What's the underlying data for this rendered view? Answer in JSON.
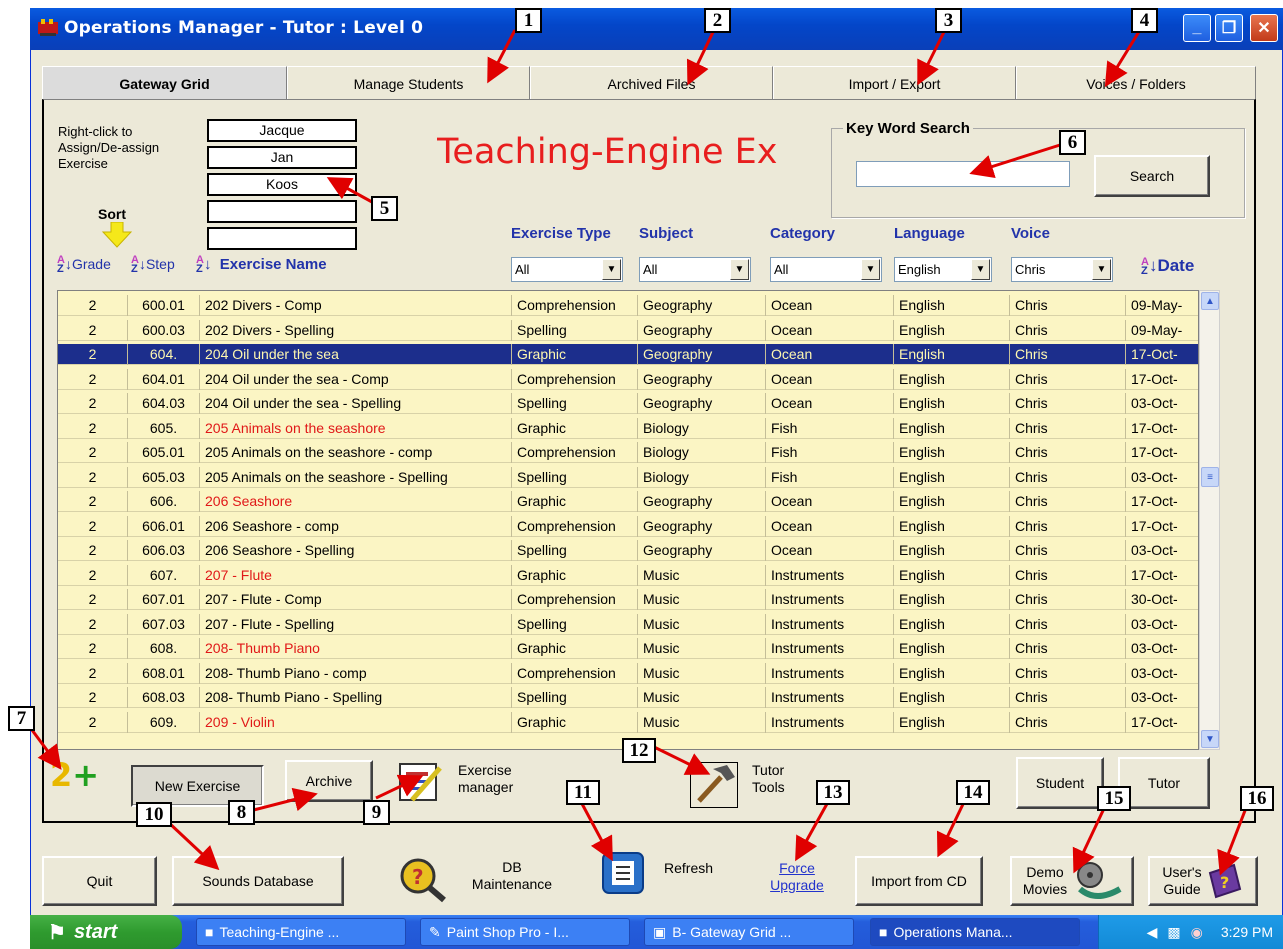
{
  "window": {
    "title": "Operations Manager - Tutor  :  Level 0",
    "controls": [
      "minimize-icon",
      "restore-icon",
      "close-icon"
    ]
  },
  "tabs": [
    {
      "label": "Gateway Grid",
      "active": true
    },
    {
      "label": "Manage Students",
      "active": false
    },
    {
      "label": "Archived Files",
      "active": false
    },
    {
      "label": "Import / Export",
      "active": false
    },
    {
      "label": "Voices / Folders",
      "active": false
    }
  ],
  "assign_hint": "Right-click to Assign/De-assign Exercise",
  "students": [
    "Jacque",
    "Jan",
    "Koos",
    "",
    ""
  ],
  "banner_title": "Teaching-Engine Ex",
  "keyword_search": {
    "label": "Key Word Search",
    "value": "",
    "button": "Search"
  },
  "sort_label": "Sort",
  "columns": {
    "grade": "Grade",
    "step": "Step",
    "exercise_name": "Exercise Name",
    "exercise_type": "Exercise Type",
    "subject": "Subject",
    "category": "Category",
    "language": "Language",
    "voice": "Voice",
    "date": "Date"
  },
  "filters": {
    "exercise_type": "All",
    "subject": "All",
    "category": "All",
    "language": "English",
    "voice": "Chris"
  },
  "rows": [
    {
      "grade": "2",
      "step": "600.01",
      "name": "202 Divers - Comp",
      "type": "Comprehension",
      "subject": "Geography",
      "category": "Ocean",
      "language": "English",
      "voice": "Chris",
      "date": "09-May-",
      "red": false,
      "selected": false
    },
    {
      "grade": "2",
      "step": "600.03",
      "name": "202 Divers - Spelling",
      "type": "Spelling",
      "subject": "Geography",
      "category": "Ocean",
      "language": "English",
      "voice": "Chris",
      "date": "09-May-",
      "red": false,
      "selected": false
    },
    {
      "grade": "2",
      "step": "604.",
      "name": "204 Oil under the sea",
      "type": "Graphic",
      "subject": "Geography",
      "category": "Ocean",
      "language": "English",
      "voice": "Chris",
      "date": "17-Oct-",
      "red": false,
      "selected": true
    },
    {
      "grade": "2",
      "step": "604.01",
      "name": "204 Oil under the sea - Comp",
      "type": "Comprehension",
      "subject": "Geography",
      "category": "Ocean",
      "language": "English",
      "voice": "Chris",
      "date": "17-Oct-",
      "red": false,
      "selected": false
    },
    {
      "grade": "2",
      "step": "604.03",
      "name": "204 Oil under the sea - Spelling",
      "type": "Spelling",
      "subject": "Geography",
      "category": "Ocean",
      "language": "English",
      "voice": "Chris",
      "date": "03-Oct-",
      "red": false,
      "selected": false
    },
    {
      "grade": "2",
      "step": "605.",
      "name": "205  Animals on the seashore",
      "type": "Graphic",
      "subject": "Biology",
      "category": "Fish",
      "language": "English",
      "voice": "Chris",
      "date": "17-Oct-",
      "red": true,
      "selected": false
    },
    {
      "grade": "2",
      "step": "605.01",
      "name": "205  Animals on the seashore - comp",
      "type": "Comprehension",
      "subject": "Biology",
      "category": "Fish",
      "language": "English",
      "voice": "Chris",
      "date": "17-Oct-",
      "red": false,
      "selected": false
    },
    {
      "grade": "2",
      "step": "605.03",
      "name": "205  Animals on the seashore - Spelling",
      "type": "Spelling",
      "subject": "Biology",
      "category": "Fish",
      "language": "English",
      "voice": "Chris",
      "date": "03-Oct-",
      "red": false,
      "selected": false
    },
    {
      "grade": "2",
      "step": "606.",
      "name": "206  Seashore",
      "type": "Graphic",
      "subject": "Geography",
      "category": "Ocean",
      "language": "English",
      "voice": "Chris",
      "date": "17-Oct-",
      "red": true,
      "selected": false
    },
    {
      "grade": "2",
      "step": "606.01",
      "name": "206  Seashore - comp",
      "type": "Comprehension",
      "subject": "Geography",
      "category": "Ocean",
      "language": "English",
      "voice": "Chris",
      "date": "17-Oct-",
      "red": false,
      "selected": false
    },
    {
      "grade": "2",
      "step": "606.03",
      "name": "206  Seashore - Spelling",
      "type": "Spelling",
      "subject": "Geography",
      "category": "Ocean",
      "language": "English",
      "voice": "Chris",
      "date": "03-Oct-",
      "red": false,
      "selected": false
    },
    {
      "grade": "2",
      "step": "607.",
      "name": "207 - Flute",
      "type": "Graphic",
      "subject": "Music",
      "category": "Instruments",
      "language": "English",
      "voice": "Chris",
      "date": "17-Oct-",
      "red": true,
      "selected": false
    },
    {
      "grade": "2",
      "step": "607.01",
      "name": "207 - Flute - Comp",
      "type": "Comprehension",
      "subject": "Music",
      "category": "Instruments",
      "language": "English",
      "voice": "Chris",
      "date": "30-Oct-",
      "red": false,
      "selected": false
    },
    {
      "grade": "2",
      "step": "607.03",
      "name": "207 - Flute - Spelling",
      "type": "Spelling",
      "subject": "Music",
      "category": "Instruments",
      "language": "English",
      "voice": "Chris",
      "date": "03-Oct-",
      "red": false,
      "selected": false
    },
    {
      "grade": "2",
      "step": "608.",
      "name": "208- Thumb Piano",
      "type": "Graphic",
      "subject": "Music",
      "category": "Instruments",
      "language": "English",
      "voice": "Chris",
      "date": "03-Oct-",
      "red": true,
      "selected": false
    },
    {
      "grade": "2",
      "step": "608.01",
      "name": "208- Thumb Piano - comp",
      "type": "Comprehension",
      "subject": "Music",
      "category": "Instruments",
      "language": "English",
      "voice": "Chris",
      "date": "03-Oct-",
      "red": false,
      "selected": false
    },
    {
      "grade": "2",
      "step": "608.03",
      "name": "208- Thumb Piano - Spelling",
      "type": "Spelling",
      "subject": "Music",
      "category": "Instruments",
      "language": "English",
      "voice": "Chris",
      "date": "03-Oct-",
      "red": false,
      "selected": false
    },
    {
      "grade": "2",
      "step": "609.",
      "name": "209 - Violin",
      "type": "Graphic",
      "subject": "Music",
      "category": "Instruments",
      "language": "English",
      "voice": "Chris",
      "date": "17-Oct-",
      "red": true,
      "selected": false
    }
  ],
  "buttons": {
    "new_exercise": "New Exercise",
    "archive": "Archive",
    "exercise_manager": "Exercise manager",
    "tutor_tools": "Tutor Tools",
    "force_upgrade": "Force Upgrade",
    "student": "Student",
    "tutor": "Tutor",
    "quit": "Quit",
    "sounds_database": "Sounds Database",
    "db_maintenance": "DB Maintenance",
    "refresh": "Refresh",
    "import_from_cd": "Import from CD",
    "demo_movies": "Demo Movies",
    "users_guide": "User's Guide"
  },
  "callouts": [
    "1",
    "2",
    "3",
    "4",
    "5",
    "6",
    "7",
    "8",
    "9",
    "10",
    "11",
    "12",
    "13",
    "14",
    "15",
    "16"
  ],
  "taskbar": {
    "start": "start",
    "tasks": [
      {
        "label": "Teaching-Engine ...",
        "active": false
      },
      {
        "label": "Paint Shop Pro - I...",
        "active": false
      },
      {
        "label": "B- Gateway Grid ...",
        "active": false
      },
      {
        "label": "Operations Mana...",
        "active": true
      }
    ],
    "clock": "3:29 PM"
  },
  "colors": {
    "title_bar": "#0346c9",
    "banner_red": "#e81e1e",
    "grid_bg": "#fbf5c4",
    "selected_row": "#1c2e8c",
    "header_blue": "#2233aa"
  }
}
